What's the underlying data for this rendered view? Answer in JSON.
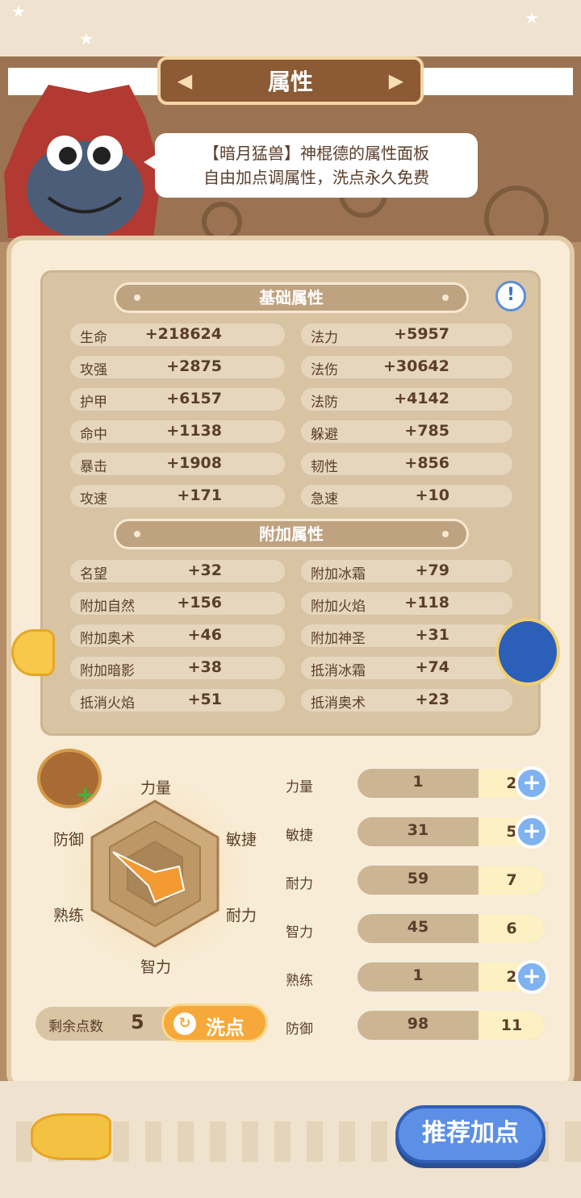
{
  "header": {
    "title": "属性"
  },
  "bubble": {
    "line1": "【暗月猛兽】神棍德的属性面板",
    "line2": "自由加点调属性，洗点永久免费"
  },
  "base_section": {
    "title": "基础属性"
  },
  "extra_section": {
    "title": "附加属性"
  },
  "base_attrs": [
    {
      "label": "生命",
      "value": "+218624"
    },
    {
      "label": "法力",
      "value": "+5957"
    },
    {
      "label": "攻强",
      "value": "+2875"
    },
    {
      "label": "法伤",
      "value": "+30642"
    },
    {
      "label": "护甲",
      "value": "+6157"
    },
    {
      "label": "法防",
      "value": "+4142"
    },
    {
      "label": "命中",
      "value": "+1138"
    },
    {
      "label": "躲避",
      "value": "+785"
    },
    {
      "label": "暴击",
      "value": "+1908"
    },
    {
      "label": "韧性",
      "value": "+856"
    },
    {
      "label": "攻速",
      "value": "+171"
    },
    {
      "label": "急速",
      "value": "+10"
    }
  ],
  "extra_attrs": [
    {
      "label": "名望",
      "value": "+32"
    },
    {
      "label": "附加冰霜",
      "value": "+79"
    },
    {
      "label": "附加自然",
      "value": "+156"
    },
    {
      "label": "附加火焰",
      "value": "+118"
    },
    {
      "label": "附加奥术",
      "value": "+46"
    },
    {
      "label": "附加神圣",
      "value": "+31"
    },
    {
      "label": "附加暗影",
      "value": "+38"
    },
    {
      "label": "抵消冰霜",
      "value": "+74"
    },
    {
      "label": "抵消火焰",
      "value": "+51"
    },
    {
      "label": "抵消奥术",
      "value": "+23"
    }
  ],
  "radar": {
    "labels": [
      "力量",
      "敏捷",
      "耐力",
      "智力",
      "熟练",
      "防御"
    ]
  },
  "stats": [
    {
      "label": "力量",
      "base": "1",
      "add": "2",
      "plus": true
    },
    {
      "label": "敏捷",
      "base": "31",
      "add": "5",
      "plus": true
    },
    {
      "label": "耐力",
      "base": "59",
      "add": "7",
      "plus": false
    },
    {
      "label": "智力",
      "base": "45",
      "add": "6",
      "plus": false
    },
    {
      "label": "熟练",
      "base": "1",
      "add": "2",
      "plus": true
    },
    {
      "label": "防御",
      "base": "98",
      "add": "11",
      "plus": false
    }
  ],
  "remaining": {
    "label": "剩余点数",
    "value": "5"
  },
  "reset_button": {
    "label": "洗点"
  },
  "recommend_button": {
    "label": "推荐加点"
  },
  "colors": {
    "accent": "#f6a93a",
    "panel": "#f8ecd6",
    "blue_button": "#5c8fe6"
  }
}
